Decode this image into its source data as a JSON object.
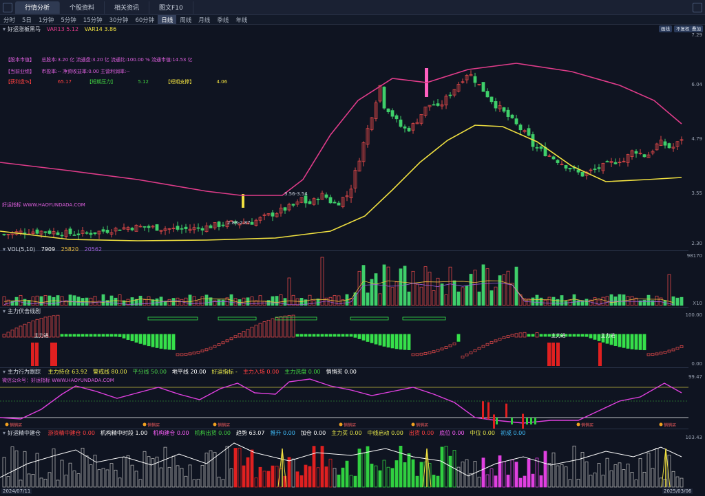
{
  "tabs": [
    "行情分析",
    "个股资料",
    "相关资讯",
    "图文F10"
  ],
  "periods": [
    "分时",
    "5日",
    "1分钟",
    "5分钟",
    "15分钟",
    "30分钟",
    "60分钟",
    "日线",
    "周线",
    "月线",
    "季线",
    "年线"
  ],
  "active_period": "日线",
  "main_pane": {
    "title": "好运涨板黑马",
    "var13": "VAR13 5.12",
    "var14": "VAR14 3.86",
    "buttons": [
      "画线",
      "不复权",
      "叠加"
    ],
    "info_line1_label": "【股本市值】",
    "info_line1_text": "总股本:3.20 亿 流通盘:3.20 亿 流通比:100.00 % 流通市值:14.53 亿",
    "info_line2_label": "【当前业绩】",
    "info_line2_text": "市盈率:-- 净资收益率:0.00 主营利润率:--",
    "info_line3_a_label": "【获利盘%】",
    "info_line3_a_value": "65.17",
    "info_line3_b_label": "【短期压力】",
    "info_line3_b_value": "5.12",
    "info_line3_c_label": "【短期支撑】",
    "info_line3_c_value": "4.06",
    "watermark": "好运指标 WWW.HAOYUNDADA.COM",
    "annot1": "3.56-3.54",
    "annot2": "2.88-2.87",
    "y_labels": [
      "7.29",
      "6.04",
      "4.79",
      "3.55",
      "2.30"
    ]
  },
  "vol_pane": {
    "title": "VOL(5,10)",
    "v1": "7909",
    "v2": "25820",
    "v3": "20562",
    "y_top": "98170",
    "y_unit": "X10"
  },
  "ambush_pane": {
    "title": "主力伏击线剧",
    "label": "主力进",
    "y_top": "100.00",
    "y_bottom": "0.00"
  },
  "behavior_pane": {
    "title": "主力行为跟踪",
    "items": [
      {
        "label": "主力持仓 63.92",
        "color": "#e8e84a"
      },
      {
        "label": "警戒线 80.00",
        "color": "#e8e84a"
      },
      {
        "label": "平分线 50.00",
        "color": "#4ad04a"
      },
      {
        "label": "地平线 20.00",
        "color": "#ffffff"
      },
      {
        "label": "好运指标 -",
        "color": "#e8e84a"
      },
      {
        "label": "主力入场 0.00",
        "color": "#ff4040"
      },
      {
        "label": "主力洗盘 0.00",
        "color": "#40d040"
      },
      {
        "label": "悄悄买 0.00",
        "color": "#ffffff"
      }
    ],
    "watermark": "微信公众号：好运指标 WWW.HAOYUNDADA.COM",
    "y_top": "99.47",
    "buy_label": "悄悄买"
  },
  "bottom_pane": {
    "title": "好运精中建仓",
    "items": [
      {
        "label": "游资精中建仓 0.00",
        "color": "#ff4040"
      },
      {
        "label": "机构精中时段 1.00",
        "color": "#ffffff"
      },
      {
        "label": "机构建仓 0.00",
        "color": "#ff60ff"
      },
      {
        "label": "机构出货 0.00",
        "color": "#40d040"
      },
      {
        "label": "趋势 63.07",
        "color": "#ffffff"
      },
      {
        "label": "推升 0.00",
        "color": "#40c0ff"
      },
      {
        "label": "加仓 0.00",
        "color": "#ffffff"
      },
      {
        "label": "主力买 0.00",
        "color": "#e8e84a"
      },
      {
        "label": "中线启动 0.00",
        "color": "#e8e84a"
      },
      {
        "label": "出货 0.00",
        "color": "#ff4040"
      },
      {
        "label": "底位 0.00",
        "color": "#ff60ff"
      },
      {
        "label": "中位 0.00",
        "color": "#e8e84a"
      },
      {
        "label": "初成 0.00",
        "color": "#40c0ff"
      }
    ],
    "y_top": "103.43",
    "date_start": "2024/07/11",
    "date_end": "2025/03/06"
  },
  "colors": {
    "up": "#e04848",
    "down": "#3fcf6a",
    "ma_pink": "#e03c8a",
    "ma_yellow": "#f0e040",
    "accent": "#2f3a52"
  }
}
